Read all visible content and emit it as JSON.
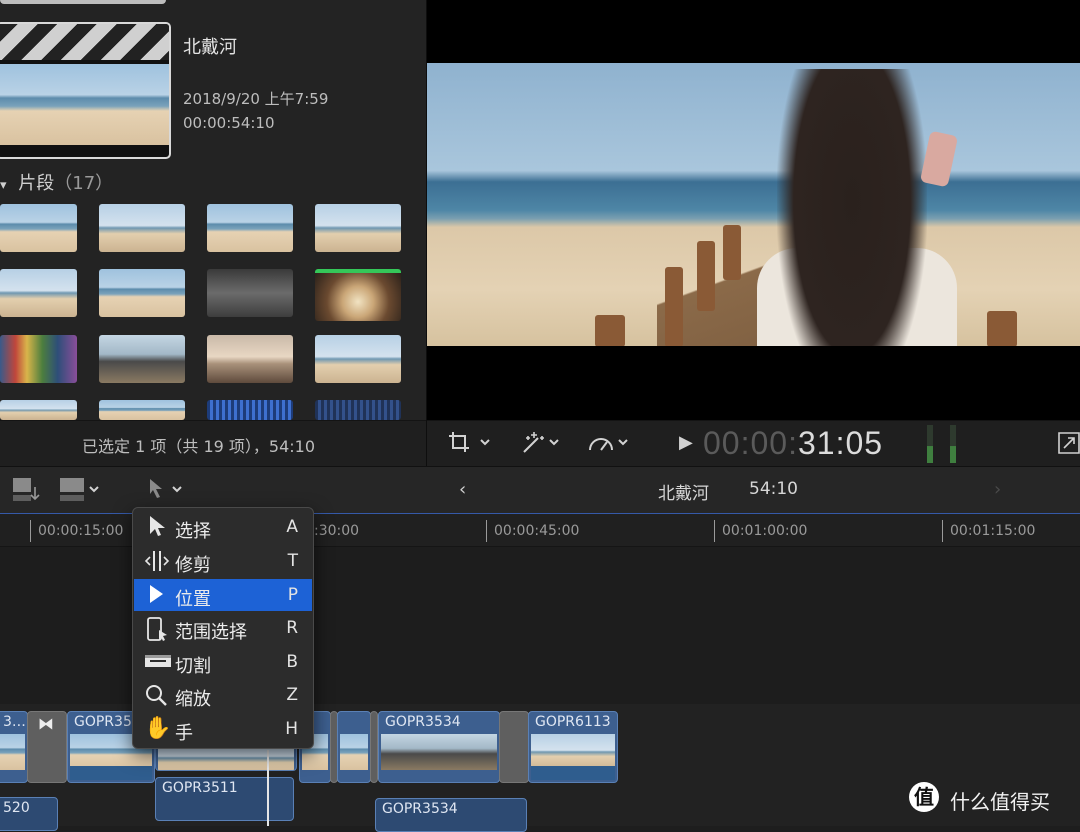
{
  "browser": {
    "event_title": "北戴河",
    "event_date": "2018/9/20 上午7:59",
    "event_duration": "00:00:54:10",
    "clips_header_label": "片段",
    "clips_header_count": "（17）",
    "selection_status": "已选定 1 项（共 19 项），54:10"
  },
  "viewer": {
    "timecode_dim": "00:00:",
    "timecode_lit": "31:05"
  },
  "timeline": {
    "project_name": "北戴河",
    "project_duration": "54:10",
    "ruler": [
      "00:00:15:00",
      ":30:00",
      "00:00:45:00",
      "00:01:00:00",
      "00:01:15:00"
    ],
    "clips": {
      "c_left": "3…",
      "c1": "GOPR35",
      "c2": "GOPR3534",
      "c3": "GOPR6113",
      "c_conn1": "GOPR3511",
      "c_conn2": "GOPR3534",
      "c_conn0": "520"
    }
  },
  "tool_menu": {
    "items": [
      {
        "label": "选择",
        "shortcut": "A",
        "icon": "arrow-icon",
        "selected": false
      },
      {
        "label": "修剪",
        "shortcut": "T",
        "icon": "trim-icon",
        "selected": false
      },
      {
        "label": "位置",
        "shortcut": "P",
        "icon": "position-icon",
        "selected": true
      },
      {
        "label": "范围选择",
        "shortcut": "R",
        "icon": "range-select-icon",
        "selected": false
      },
      {
        "label": "切割",
        "shortcut": "B",
        "icon": "blade-icon",
        "selected": false
      },
      {
        "label": "缩放",
        "shortcut": "Z",
        "icon": "zoom-icon",
        "selected": false
      },
      {
        "label": "手",
        "shortcut": "H",
        "icon": "hand-icon",
        "selected": false
      }
    ]
  },
  "watermark": {
    "glyph": "值",
    "text": "什么值得买"
  },
  "colors": {
    "accent": "#1d62d6",
    "clip": "#3d5f8f",
    "background": "#1e1e1e"
  }
}
